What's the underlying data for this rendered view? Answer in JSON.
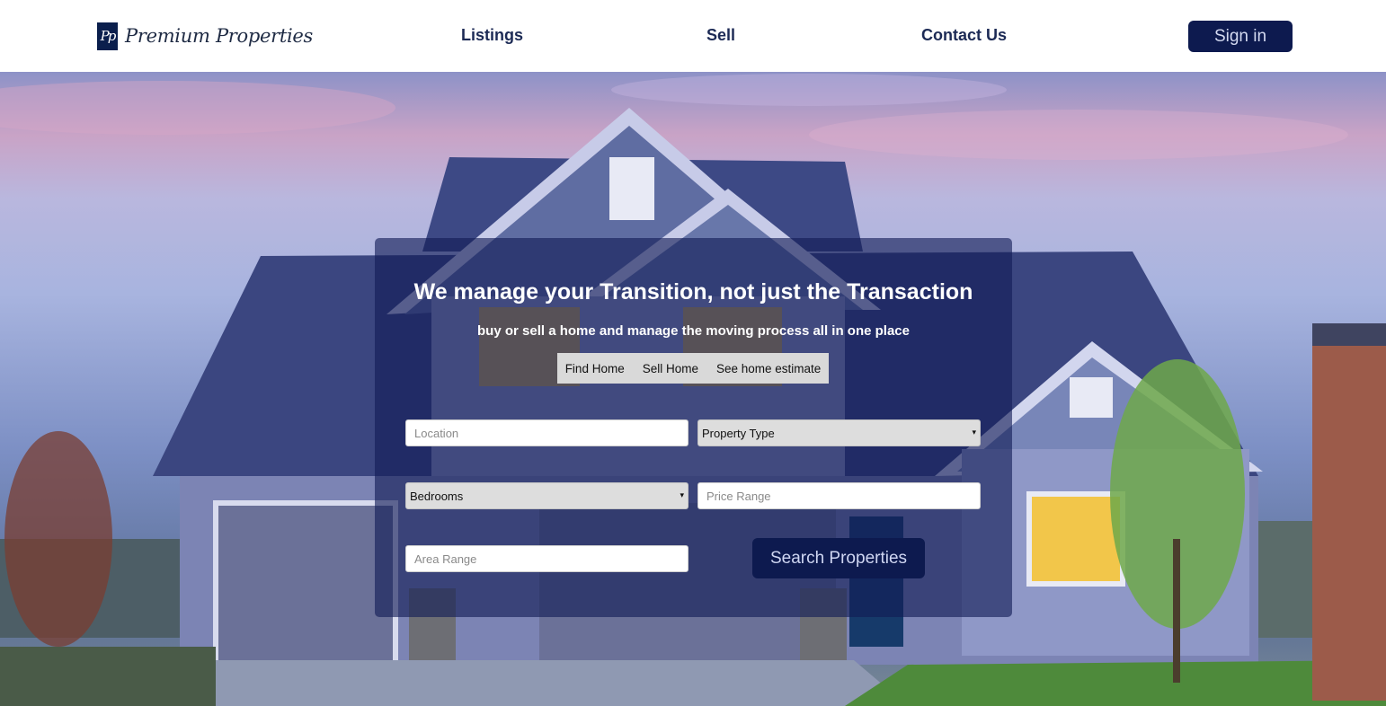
{
  "brand": {
    "logo_mark": "Pp",
    "name": "Premium Properties"
  },
  "nav": {
    "items": [
      {
        "label": "Listings"
      },
      {
        "label": "Sell"
      },
      {
        "label": "Contact Us"
      }
    ],
    "signin_label": "Sign in"
  },
  "hero": {
    "headline": "We manage your Transition, not just the Transaction",
    "subheadline": "buy or sell a home and manage the moving process all in one place",
    "tabs": [
      {
        "label": "Find Home"
      },
      {
        "label": "Sell Home"
      },
      {
        "label": "See home estimate"
      }
    ]
  },
  "search": {
    "location_placeholder": "Location",
    "property_type_selected": "Property Type",
    "bedrooms_selected": "Bedrooms",
    "price_range_placeholder": "Price Range",
    "area_range_placeholder": "Area Range",
    "submit_label": "Search Properties"
  },
  "colors": {
    "brand_navy": "#0d1a4f",
    "nav_text": "#1c2a55",
    "panel_overlay": "rgba(18, 28, 85, 0.62)"
  },
  "icons": {
    "select_caret": "▾"
  }
}
